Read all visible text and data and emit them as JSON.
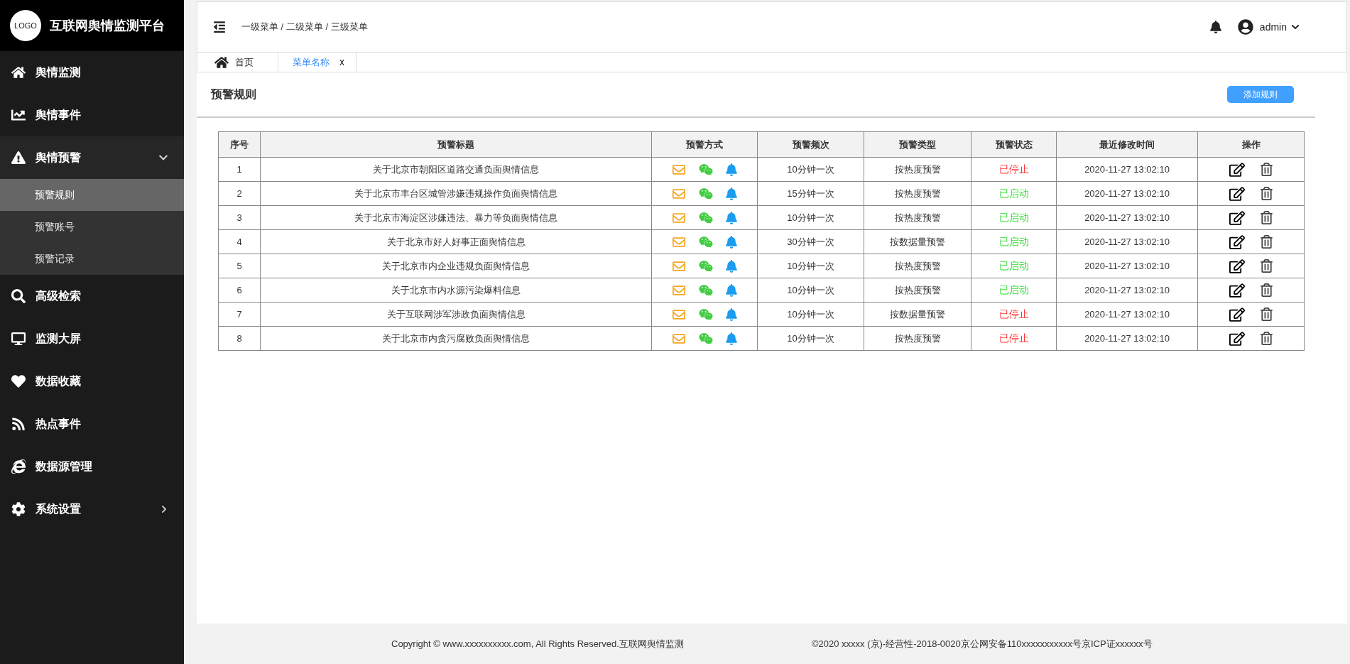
{
  "app": {
    "logo": "LOGO",
    "title": "互联网舆情监测平台"
  },
  "sidebar": {
    "items": [
      {
        "label": "舆情监测",
        "selected": false
      },
      {
        "label": "舆情事件",
        "selected": false
      },
      {
        "label": "舆情预警",
        "selected": false,
        "expanded": true,
        "children": [
          {
            "label": "预警规则",
            "selected": true
          },
          {
            "label": "预警账号",
            "selected": false
          },
          {
            "label": "预警记录",
            "selected": false
          }
        ]
      },
      {
        "label": "高级检索",
        "selected": false
      },
      {
        "label": "监测大屏",
        "selected": false
      },
      {
        "label": "数据收藏",
        "selected": false
      },
      {
        "label": "热点事件",
        "selected": false
      },
      {
        "label": "数据源管理",
        "selected": false
      },
      {
        "label": "系统设置",
        "selected": false,
        "expanded": false
      }
    ]
  },
  "header": {
    "breadcrumb": "一级菜单 / 二级菜单 / 三级菜单",
    "user": "admin"
  },
  "tabs": [
    {
      "label": "首页",
      "selected": false
    },
    {
      "label": "菜单名称",
      "selected": true,
      "close": "x"
    }
  ],
  "page": {
    "title": "预警规则",
    "add_button": "添加规则"
  },
  "table": {
    "columns": [
      "序号",
      "预警标题",
      "预警方式",
      "预警频次",
      "预警类型",
      "预警状态",
      "最近修改时间",
      "操作"
    ],
    "rows": [
      {
        "no": "1",
        "title": "关于北京市朝阳区道路交通负面舆情信息",
        "frequency": "10分钟一次",
        "type": "按热度预警",
        "status": "已停止",
        "color": "#ff3333",
        "time": "2020-11-27 13:02:10"
      },
      {
        "no": "2",
        "title": "关于北京市丰台区城管涉嫌违规操作负面舆情信息",
        "frequency": "15分钟一次",
        "type": "按热度预警",
        "status": "已启动",
        "color": "#33dd33",
        "time": "2020-11-27 13:02:10"
      },
      {
        "no": "3",
        "title": "关于北京市海淀区涉嫌违法、暴力等负面舆情信息",
        "frequency": "10分钟一次",
        "type": "按热度预警",
        "status": "已启动",
        "color": "#33dd33",
        "time": "2020-11-27 13:02:10"
      },
      {
        "no": "4",
        "title": "关于北京市好人好事正面舆情信息",
        "frequency": "30分钟一次",
        "type": "按数据量预警",
        "status": "已启动",
        "color": "#33dd33",
        "time": "2020-11-27 13:02:10"
      },
      {
        "no": "5",
        "title": "关于北京市内企业违规负面舆情信息",
        "frequency": "10分钟一次",
        "type": "按热度预警",
        "status": "已启动",
        "color": "#33dd33",
        "time": "2020-11-27 13:02:10"
      },
      {
        "no": "6",
        "title": "关于北京市内水源污染爆料信息",
        "frequency": "10分钟一次",
        "type": "按热度预警",
        "status": "已启动",
        "color": "#33dd33",
        "time": "2020-11-27 13:02:10"
      },
      {
        "no": "7",
        "title": "关于互联网涉军涉政负面舆情信息",
        "frequency": "10分钟一次",
        "type": "按数据量预警",
        "status": "已停止",
        "color": "#ff3333",
        "time": "2020-11-27 13:02:10"
      },
      {
        "no": "8",
        "title": "关于北京市内贪污腐败负面舆情信息",
        "frequency": "10分钟一次",
        "type": "按热度预警",
        "status": "已停止",
        "color": "#ff3333",
        "time": "2020-11-27 13:02:10"
      }
    ]
  },
  "footer": {
    "copyright": "Copyright © www.xxxxxxxxxx.com, All Rights Reserved.互联网舆情监测",
    "license": "©2020 xxxxx (京)-经营性-2018-0020京公网安备110xxxxxxxxxxx号京ICP证xxxxxx号"
  }
}
